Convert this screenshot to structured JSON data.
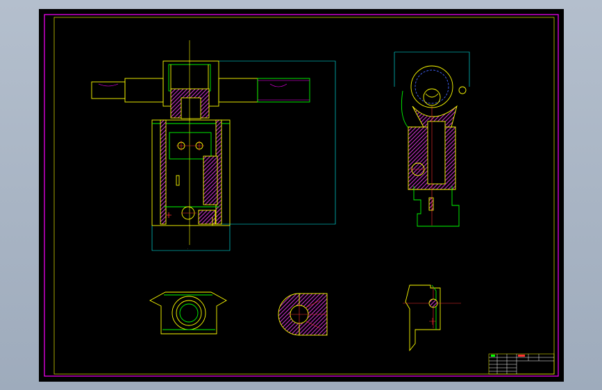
{
  "drawing": {
    "layout_colors": {
      "background": "#000000",
      "page_border": "#ff00ff",
      "outline": "#ffff00",
      "edges": "#00ff00",
      "dimensions": "#00ffff",
      "section_hatch": "#cc33cc",
      "centerlines": "#ff3030",
      "hidden": "#4466ff"
    },
    "views": [
      "front-section-view",
      "side-section-view",
      "bottom-view",
      "detail-section-a",
      "detail-section-b"
    ],
    "title_block": {
      "rows": 6,
      "columns": 5
    }
  }
}
